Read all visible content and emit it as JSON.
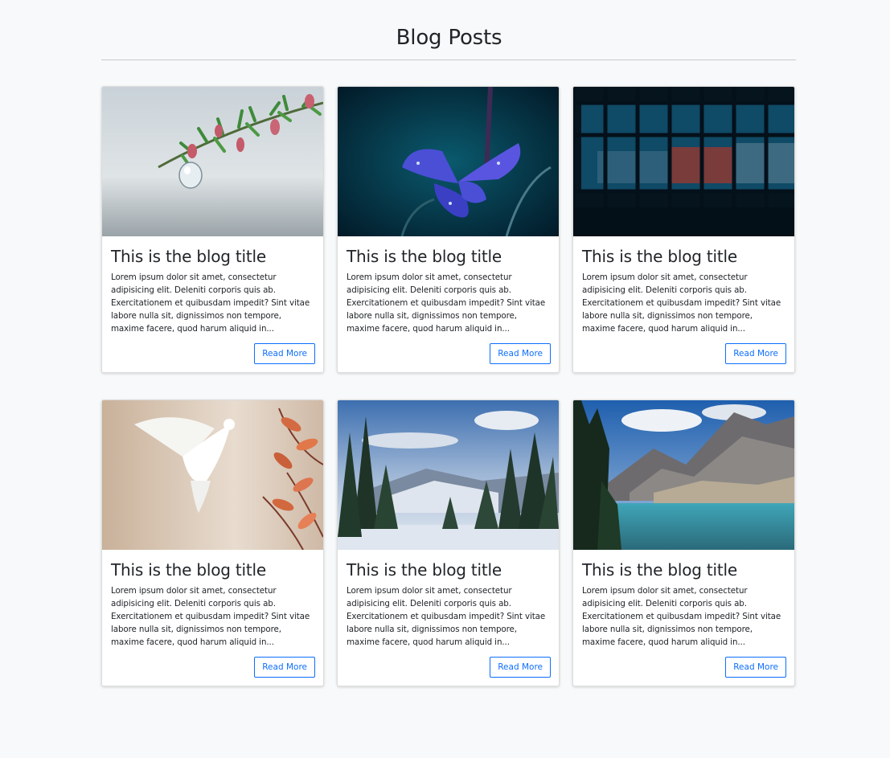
{
  "header": {
    "title": "Blog Posts"
  },
  "posts": [
    {
      "image": "photo-cypress-branch-with-water-drop",
      "title": "This is the blog title",
      "excerpt": "Lorem ipsum dolor sit amet, consectetur adipisicing elit. Deleniti corporis quis ab. Exercitationem et quibusdam impedit? Sint vitae labore nulla sit, dignissimos non tempore, maxime facere, quod harum aliquid in...",
      "button_label": "Read More"
    },
    {
      "image": "photo-blue-iris-flower-with-dew",
      "title": "This is the blog title",
      "excerpt": "Lorem ipsum dolor sit amet, consectetur adipisicing elit. Deleniti corporis quis ab. Exercitationem et quibusdam impedit? Sint vitae labore nulla sit, dignissimos non tempore, maxime facere, quod harum aliquid in...",
      "button_label": "Read More"
    },
    {
      "image": "photo-library-interior-at-night",
      "title": "This is the blog title",
      "excerpt": "Lorem ipsum dolor sit amet, consectetur adipisicing elit. Deleniti corporis quis ab. Exercitationem et quibusdam impedit? Sint vitae labore nulla sit, dignissimos non tempore, maxime facere, quod harum aliquid in...",
      "button_label": "Read More"
    },
    {
      "image": "photo-white-dove-autumn-leaves",
      "title": "This is the blog title",
      "excerpt": "Lorem ipsum dolor sit amet, consectetur adipisicing elit. Deleniti corporis quis ab. Exercitationem et quibusdam impedit? Sint vitae labore nulla sit, dignissimos non tempore, maxime facere, quod harum aliquid in...",
      "button_label": "Read More"
    },
    {
      "image": "photo-snowy-pine-forest",
      "title": "This is the blog title",
      "excerpt": "Lorem ipsum dolor sit amet, consectetur adipisicing elit. Deleniti corporis quis ab. Exercitationem et quibusdam impedit? Sint vitae labore nulla sit, dignissimos non tempore, maxime facere, quod harum aliquid in...",
      "button_label": "Read More"
    },
    {
      "image": "photo-mountain-lake",
      "title": "This is the blog title",
      "excerpt": "Lorem ipsum dolor sit amet, consectetur adipisicing elit. Deleniti corporis quis ab. Exercitationem et quibusdam impedit? Sint vitae labore nulla sit, dignissimos non tempore, maxime facere, quod harum aliquid in...",
      "button_label": "Read More"
    }
  ],
  "colors": {
    "accent": "#0d6efd",
    "page_background": "#f8f9fa",
    "text": "#212529"
  }
}
